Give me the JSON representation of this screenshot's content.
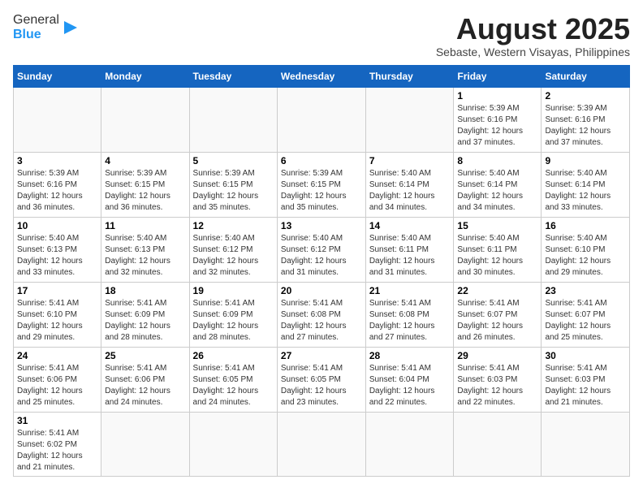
{
  "header": {
    "logo_general": "General",
    "logo_blue": "Blue",
    "title": "August 2025",
    "subtitle": "Sebaste, Western Visayas, Philippines"
  },
  "weekdays": [
    "Sunday",
    "Monday",
    "Tuesday",
    "Wednesday",
    "Thursday",
    "Friday",
    "Saturday"
  ],
  "weeks": [
    [
      {
        "day": "",
        "info": ""
      },
      {
        "day": "",
        "info": ""
      },
      {
        "day": "",
        "info": ""
      },
      {
        "day": "",
        "info": ""
      },
      {
        "day": "",
        "info": ""
      },
      {
        "day": "1",
        "info": "Sunrise: 5:39 AM\nSunset: 6:16 PM\nDaylight: 12 hours and 37 minutes."
      },
      {
        "day": "2",
        "info": "Sunrise: 5:39 AM\nSunset: 6:16 PM\nDaylight: 12 hours and 37 minutes."
      }
    ],
    [
      {
        "day": "3",
        "info": "Sunrise: 5:39 AM\nSunset: 6:16 PM\nDaylight: 12 hours and 36 minutes."
      },
      {
        "day": "4",
        "info": "Sunrise: 5:39 AM\nSunset: 6:15 PM\nDaylight: 12 hours and 36 minutes."
      },
      {
        "day": "5",
        "info": "Sunrise: 5:39 AM\nSunset: 6:15 PM\nDaylight: 12 hours and 35 minutes."
      },
      {
        "day": "6",
        "info": "Sunrise: 5:39 AM\nSunset: 6:15 PM\nDaylight: 12 hours and 35 minutes."
      },
      {
        "day": "7",
        "info": "Sunrise: 5:40 AM\nSunset: 6:14 PM\nDaylight: 12 hours and 34 minutes."
      },
      {
        "day": "8",
        "info": "Sunrise: 5:40 AM\nSunset: 6:14 PM\nDaylight: 12 hours and 34 minutes."
      },
      {
        "day": "9",
        "info": "Sunrise: 5:40 AM\nSunset: 6:14 PM\nDaylight: 12 hours and 33 minutes."
      }
    ],
    [
      {
        "day": "10",
        "info": "Sunrise: 5:40 AM\nSunset: 6:13 PM\nDaylight: 12 hours and 33 minutes."
      },
      {
        "day": "11",
        "info": "Sunrise: 5:40 AM\nSunset: 6:13 PM\nDaylight: 12 hours and 32 minutes."
      },
      {
        "day": "12",
        "info": "Sunrise: 5:40 AM\nSunset: 6:12 PM\nDaylight: 12 hours and 32 minutes."
      },
      {
        "day": "13",
        "info": "Sunrise: 5:40 AM\nSunset: 6:12 PM\nDaylight: 12 hours and 31 minutes."
      },
      {
        "day": "14",
        "info": "Sunrise: 5:40 AM\nSunset: 6:11 PM\nDaylight: 12 hours and 31 minutes."
      },
      {
        "day": "15",
        "info": "Sunrise: 5:40 AM\nSunset: 6:11 PM\nDaylight: 12 hours and 30 minutes."
      },
      {
        "day": "16",
        "info": "Sunrise: 5:40 AM\nSunset: 6:10 PM\nDaylight: 12 hours and 29 minutes."
      }
    ],
    [
      {
        "day": "17",
        "info": "Sunrise: 5:41 AM\nSunset: 6:10 PM\nDaylight: 12 hours and 29 minutes."
      },
      {
        "day": "18",
        "info": "Sunrise: 5:41 AM\nSunset: 6:09 PM\nDaylight: 12 hours and 28 minutes."
      },
      {
        "day": "19",
        "info": "Sunrise: 5:41 AM\nSunset: 6:09 PM\nDaylight: 12 hours and 28 minutes."
      },
      {
        "day": "20",
        "info": "Sunrise: 5:41 AM\nSunset: 6:08 PM\nDaylight: 12 hours and 27 minutes."
      },
      {
        "day": "21",
        "info": "Sunrise: 5:41 AM\nSunset: 6:08 PM\nDaylight: 12 hours and 27 minutes."
      },
      {
        "day": "22",
        "info": "Sunrise: 5:41 AM\nSunset: 6:07 PM\nDaylight: 12 hours and 26 minutes."
      },
      {
        "day": "23",
        "info": "Sunrise: 5:41 AM\nSunset: 6:07 PM\nDaylight: 12 hours and 25 minutes."
      }
    ],
    [
      {
        "day": "24",
        "info": "Sunrise: 5:41 AM\nSunset: 6:06 PM\nDaylight: 12 hours and 25 minutes."
      },
      {
        "day": "25",
        "info": "Sunrise: 5:41 AM\nSunset: 6:06 PM\nDaylight: 12 hours and 24 minutes."
      },
      {
        "day": "26",
        "info": "Sunrise: 5:41 AM\nSunset: 6:05 PM\nDaylight: 12 hours and 24 minutes."
      },
      {
        "day": "27",
        "info": "Sunrise: 5:41 AM\nSunset: 6:05 PM\nDaylight: 12 hours and 23 minutes."
      },
      {
        "day": "28",
        "info": "Sunrise: 5:41 AM\nSunset: 6:04 PM\nDaylight: 12 hours and 22 minutes."
      },
      {
        "day": "29",
        "info": "Sunrise: 5:41 AM\nSunset: 6:03 PM\nDaylight: 12 hours and 22 minutes."
      },
      {
        "day": "30",
        "info": "Sunrise: 5:41 AM\nSunset: 6:03 PM\nDaylight: 12 hours and 21 minutes."
      }
    ],
    [
      {
        "day": "31",
        "info": "Sunrise: 5:41 AM\nSunset: 6:02 PM\nDaylight: 12 hours and 21 minutes."
      },
      {
        "day": "",
        "info": ""
      },
      {
        "day": "",
        "info": ""
      },
      {
        "day": "",
        "info": ""
      },
      {
        "day": "",
        "info": ""
      },
      {
        "day": "",
        "info": ""
      },
      {
        "day": "",
        "info": ""
      }
    ]
  ]
}
